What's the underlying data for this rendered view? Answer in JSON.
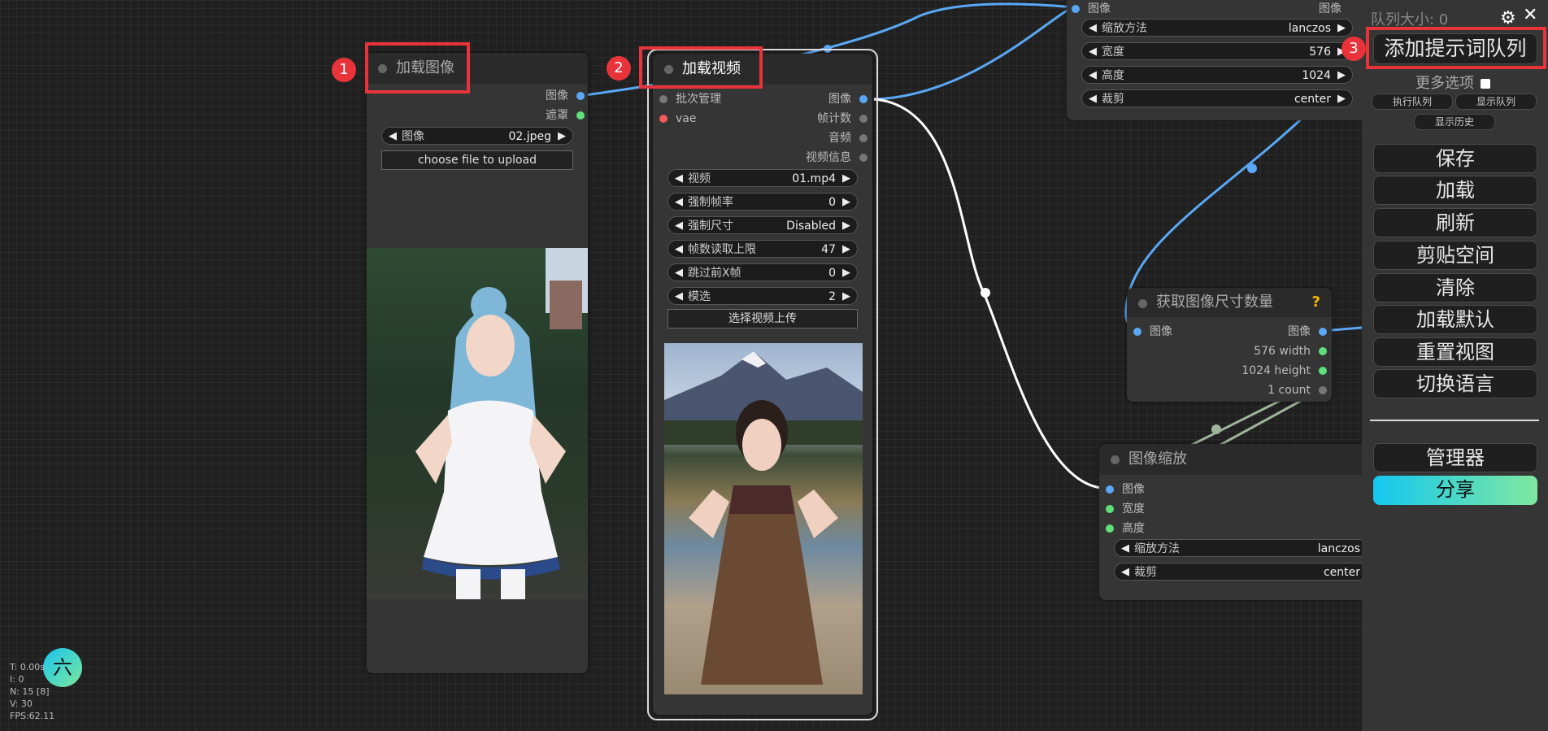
{
  "nodes": {
    "load_image": {
      "badge": "1",
      "title": "加载图像",
      "outputs": [
        "图像",
        "遮罩"
      ],
      "widget": {
        "label": "图像",
        "value": "02.jpeg"
      },
      "upload_label": "choose file to upload"
    },
    "load_video": {
      "badge": "2",
      "title": "加载视频",
      "inputs": [
        "批次管理",
        "vae"
      ],
      "outputs": [
        "图像",
        "帧计数",
        "音频",
        "视频信息"
      ],
      "widgets": [
        {
          "label": "视频",
          "value": "01.mp4"
        },
        {
          "label": "强制帧率",
          "value": "0"
        },
        {
          "label": "强制尺寸",
          "value": "Disabled"
        },
        {
          "label": "帧数读取上限",
          "value": "47"
        },
        {
          "label": "跳过前X帧",
          "value": "0"
        },
        {
          "label": "模选",
          "value": "2"
        }
      ],
      "upload_label": "选择视频上传"
    },
    "top_scale": {
      "input": "图像",
      "output": "图像",
      "widgets": [
        {
          "label": "缩放方法",
          "value": "lanczos"
        },
        {
          "label": "宽度",
          "value": "576"
        },
        {
          "label": "高度",
          "value": "1024"
        },
        {
          "label": "裁剪",
          "value": "center"
        }
      ]
    },
    "get_size": {
      "title": "获取图像尺寸数量",
      "help": "?",
      "input": "图像",
      "outputs": [
        "图像",
        "576 width",
        "1024 height",
        "1 count"
      ]
    },
    "image_scale": {
      "title": "图像缩放",
      "inputs": [
        "图像",
        "宽度",
        "高度"
      ],
      "widgets": [
        {
          "label": "缩放方法",
          "value": "lanczos"
        },
        {
          "label": "裁剪",
          "value": "center"
        }
      ]
    }
  },
  "menu": {
    "queue_size": "队列大小: 0",
    "badge": "3",
    "queue_prompt": "添加提示词队列",
    "more_options": "更多选项",
    "small_buttons": [
      "执行队列",
      "显示队列",
      "显示历史"
    ],
    "buttons": [
      "保存",
      "加载",
      "刷新",
      "剪贴空间",
      "清除",
      "加载默认",
      "重置视图",
      "切换语言"
    ],
    "manager": "管理器",
    "share": "分享",
    "close": "✕",
    "settings_icon": "gear-icon"
  },
  "stats": {
    "t": "T: 0.00s",
    "i": "I: 0",
    "n": "N: 15 [8]",
    "v": "V: 30",
    "fps": "FPS:62.11"
  },
  "logo": "六",
  "colors": {
    "accent_red": "#e8333a",
    "wire_blue": "#5aa8f5",
    "wire_white": "#ffffff",
    "wire_green": "#9fb59a"
  }
}
